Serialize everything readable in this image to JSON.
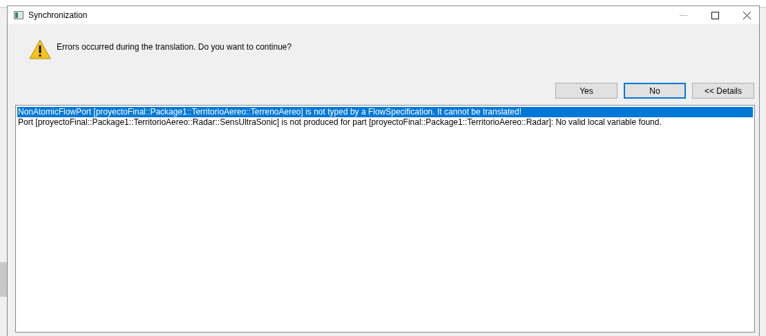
{
  "window": {
    "title": "Synchronization"
  },
  "message": "Errors occurred during the translation. Do you want to continue?",
  "buttons": [
    {
      "label": "Yes",
      "default": false
    },
    {
      "label": "No",
      "default": true
    },
    {
      "label": "<< Details",
      "default": false
    }
  ],
  "details": [
    {
      "text": "NonAtomicFlowPort [proyectoFinal::Package1::TerritorioAereo::TerrenoAereo] is not typed by a FlowSpecification. It cannot be translated!",
      "selected": true
    },
    {
      "text": "Port [proyectoFinal::Package1::TerritorioAereo::Radar::SensUltraSonic] is not produced for part [proyectoFinal::Package1::TerritorioAereo::Radar]: No valid local variable found.",
      "selected": false
    }
  ]
}
